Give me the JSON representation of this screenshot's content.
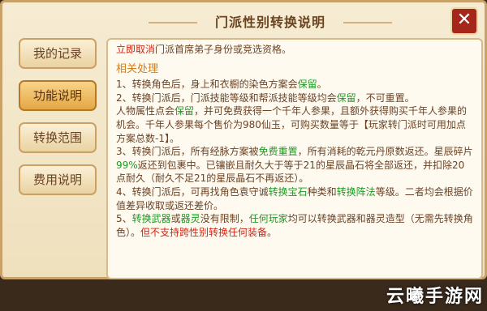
{
  "window": {
    "title": "门派性别转换说明",
    "close_label": "✕"
  },
  "sidebar": {
    "items": [
      {
        "label": "我的记录"
      },
      {
        "label": "功能说明"
      },
      {
        "label": "转换范围"
      },
      {
        "label": "费用说明"
      }
    ],
    "active_index": 1
  },
  "content": {
    "intro_prefix": "立即取消",
    "intro_suffix": "门派首席弟子身份或竞选资格。",
    "section_title": "相关处理",
    "items": [
      {
        "p1": "1、转换角色后，身上和衣橱的染色方案会",
        "g1": "保留",
        "p2": "。"
      },
      {
        "p1": "2、转换门派后，门派技能等级和帮派技能等级均会",
        "g1": "保留",
        "p2": "，不可重置。"
      },
      {
        "p1": "人物属性点会",
        "g1": "保留",
        "p2": "，并可免费获得一个千年人参果，且额外获得购买千年人参果的机会。千年人参果每个售价为980仙玉，可购买数量等于【玩家转门派时可用加点方案总数-1】。"
      },
      {
        "p1": "3、转换门派后，所有经脉方案被",
        "g1": "免费重置",
        "p2": "，所有消耗的乾元丹原数返还。星辰碎片",
        "g2": "99%",
        "p3": "返还到包裹中。已镶嵌且耐久大于等于21的星辰晶石将全部返还，并扣除20点耐久（耐久不足21的星辰晶石不再返还）。"
      },
      {
        "p1": "4、转换门派后，可再找角色袁守诚",
        "g1": "转换宝石",
        "p2": "种类和",
        "g2": "转换阵法",
        "p3": "等级。二者均会根据价值差异收取或返还差价。"
      },
      {
        "p1": "5、",
        "g1": "转换武器",
        "p2": "或",
        "g2": "器灵",
        "p3": "没有限制，",
        "g3": "任何玩家",
        "p4": "均可以转换武器和器灵造型（无需先转换角色）。",
        "r1": "但不支持跨性别转换任何装备",
        "p5": "。"
      }
    ]
  },
  "watermark": "云曦手游网",
  "colors": {
    "accent_green": "#1d9a22",
    "accent_red": "#d42412",
    "section_orange": "#d47f1a"
  }
}
